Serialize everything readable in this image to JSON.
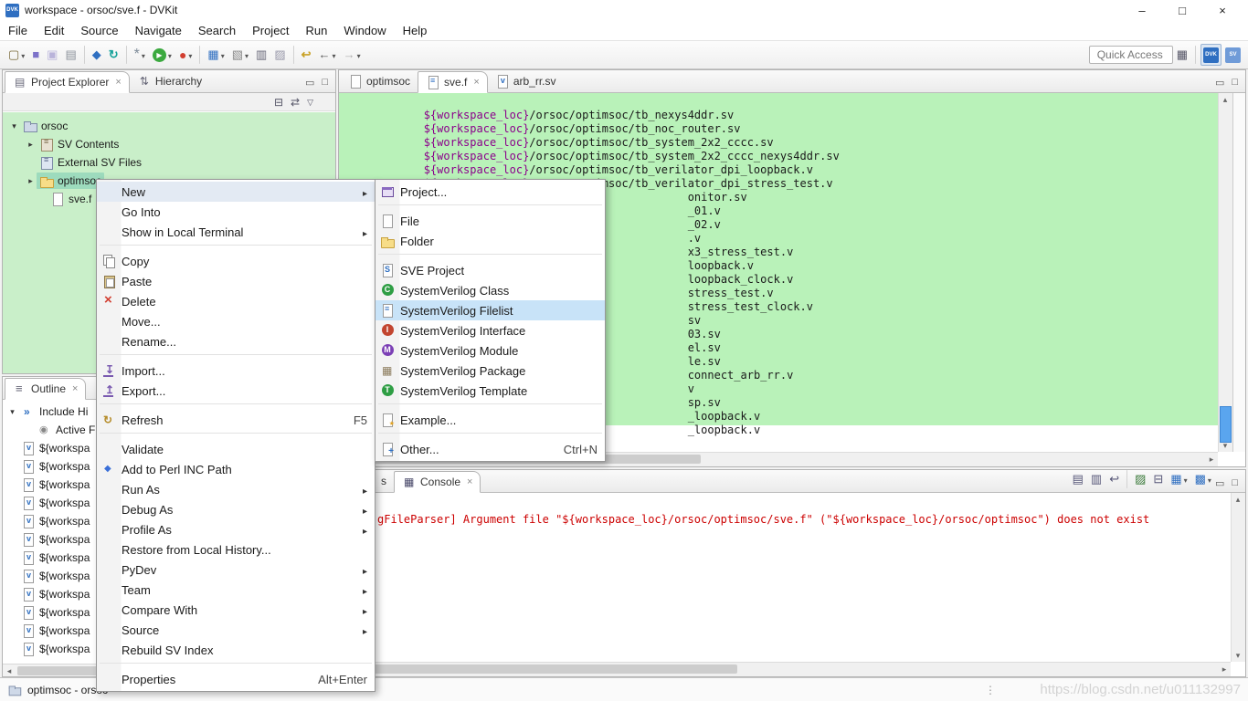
{
  "window": {
    "title": "workspace - orsoc/sve.f - DVKit",
    "logo_text": "DVK",
    "minimize": "–",
    "maximize": "□",
    "close": "×"
  },
  "menubar": [
    "File",
    "Edit",
    "Source",
    "Navigate",
    "Search",
    "Project",
    "Run",
    "Window",
    "Help"
  ],
  "panel_buttons": {
    "minimize": "▭",
    "maximize": "□"
  },
  "colors": {
    "accent_blue": "#2f6fc1",
    "selection_green": "#b9f2b9",
    "explorer_green": "#c9efc9",
    "tree_selection_green": "#9ddbbd",
    "menu_highlight_blue": "#c8e3f8",
    "error_red": "#cc0000",
    "variable_purple": "#8b008b"
  },
  "toolbar": {
    "quick_access": "Quick Access",
    "buttons": [
      {
        "name": "new-wizard",
        "glyph": "▢",
        "gstyle": "color:#7a6a3a",
        "drop": true
      },
      {
        "name": "save",
        "glyph": "■",
        "gstyle": "color:#7d72c9"
      },
      {
        "name": "save-all",
        "glyph": "▣",
        "gstyle": "color:#b9b3da"
      },
      {
        "name": "print",
        "glyph": "▤",
        "gstyle": "color:#8a9099"
      },
      {
        "cls": "tb-sep"
      },
      {
        "name": "build-sv-index",
        "glyph": "◆",
        "gstyle": "color:#2f6fc1"
      },
      {
        "name": "sync-terminal",
        "glyph": "↻",
        "gstyle": "color:#18a39b;font-weight:bold"
      },
      {
        "cls": "tb-sep"
      },
      {
        "name": "new-sv-item",
        "glyph": "*",
        "gstyle": "color:#7f8c99;font-size:16px",
        "drop": true
      },
      {
        "name": "run",
        "glyph": "▶",
        "gstyle": "color:#fff;background:#3ba93f;border-radius:50%;width:15px;height:15px;line-height:15px;text-align:center;font-size:8px",
        "drop": true
      },
      {
        "name": "run-external-tools",
        "glyph": "●",
        "gstyle": "color:#d23f31;font-size:14px",
        "drop": true
      },
      {
        "cls": "tb-sep"
      },
      {
        "name": "simulate",
        "glyph": "▦",
        "gstyle": "color:#2f6fc1",
        "drop": true
      },
      {
        "name": "coverage",
        "glyph": "▧",
        "gstyle": "color:#888",
        "drop": true
      },
      {
        "name": "windows",
        "glyph": "▥",
        "gstyle": "color:#667"
      },
      {
        "name": "editor-area",
        "glyph": "▨",
        "gstyle": "color:#99a"
      },
      {
        "cls": "tb-sep"
      },
      {
        "name": "last-edit-location",
        "glyph": "↩",
        "gstyle": "color:#c9a227;font-weight:bold"
      },
      {
        "name": "back",
        "glyph": "←",
        "gstyle": "color:#555;font-weight:bold",
        "drop": true
      },
      {
        "name": "forward",
        "glyph": "→",
        "gstyle": "color:#b0b0b0;font-weight:bold",
        "drop": true
      }
    ],
    "right_buttons": [
      {
        "name": "open-perspective",
        "glyph": "▦",
        "gstyle": "color:#556"
      },
      {
        "cls": "tb-sep"
      },
      {
        "name": "perspective-dvkit",
        "logo": "DVK",
        "cls": "persp active"
      },
      {
        "name": "perspective-sve",
        "logo": "SV",
        "cls": "persp persp2"
      }
    ]
  },
  "explorer": {
    "tabs": [
      {
        "label": "Project Explorer",
        "icon": "ic-explorer",
        "cls": "active",
        "close": "×"
      },
      {
        "label": "Hierarchy",
        "icon": "ic-hierarchy"
      }
    ],
    "toolbar": [
      {
        "name": "collapse-all",
        "glyph": "⊟",
        "gstyle": "color:#556;font-size:12px"
      },
      {
        "name": "link-with-editor",
        "glyph": "⇄",
        "gstyle": "color:#556;font-size:12px"
      },
      {
        "name": "view-menu",
        "glyph": "▽",
        "gstyle": "color:#556;font-size:9px"
      }
    ],
    "tree": [
      {
        "label": "orsoc",
        "arrow": "▾",
        "icon": "ic-project",
        "style": "padding-left:6px"
      },
      {
        "label": "SV Contents",
        "arrow": "▸",
        "icon": "ic-library",
        "style": "padding-left:24px"
      },
      {
        "label": "External SV Files",
        "arrow": "",
        "icon": "ic-extlib",
        "style": "padding-left:24px"
      },
      {
        "label": "optimsoc",
        "arrow": "▸",
        "icon": "ic-folder",
        "style": "padding-left:24px",
        "selcls": "sel"
      },
      {
        "label": "sve.f",
        "arrow": "",
        "icon": "ic-file",
        "style": "padding-left:36px"
      }
    ]
  },
  "outline": {
    "tabs": [
      {
        "label": "Outline",
        "icon": "ic-outline",
        "cls": "active",
        "close": "×"
      }
    ],
    "items": [
      {
        "label": "Include Hi",
        "arrow": "▾",
        "icon": "ic-includes"
      },
      {
        "label": "Active F",
        "arrow": "",
        "icon": "ic-active",
        "style": "padding-left:18px"
      },
      {
        "label": "${workspa",
        "arrow": "",
        "icon": "ic-vfile"
      },
      {
        "label": "${workspa",
        "arrow": "",
        "icon": "ic-vfile"
      },
      {
        "label": "${workspa",
        "arrow": "",
        "icon": "ic-vfile"
      },
      {
        "label": "${workspa",
        "arrow": "",
        "icon": "ic-vfile"
      },
      {
        "label": "${workspa",
        "arrow": "",
        "icon": "ic-vfile"
      },
      {
        "label": "${workspa",
        "arrow": "",
        "icon": "ic-vfile"
      },
      {
        "label": "${workspa",
        "arrow": "",
        "icon": "ic-vfile"
      },
      {
        "label": "${workspa",
        "arrow": "",
        "icon": "ic-vfile"
      },
      {
        "label": "${workspa",
        "arrow": "",
        "icon": "ic-vfile"
      },
      {
        "label": "${workspa",
        "arrow": "",
        "icon": "ic-vfile"
      },
      {
        "label": "${workspa",
        "arrow": "",
        "icon": "ic-vfile"
      },
      {
        "label": "${workspa",
        "arrow": "",
        "icon": "ic-vfile"
      }
    ]
  },
  "editor": {
    "tabs": [
      {
        "label": "optimsoc",
        "icon": "ic-file"
      },
      {
        "label": "sve.f",
        "icon": "ic-svfilelist",
        "cls": "active",
        "close": "×"
      },
      {
        "label": "arb_rr.sv",
        "icon": "ic-vfile"
      }
    ],
    "lines": [
      {
        "v": "${workspace_loc}",
        "t": "/orsoc/optimsoc/tb_nexys4ddr.sv",
        "style": "padding-left:6px"
      },
      {
        "v": "${workspace_loc}",
        "t": "/orsoc/optimsoc/tb_noc_router.sv",
        "style": "padding-left:6px"
      },
      {
        "v": "${workspace_loc}",
        "t": "/orsoc/optimsoc/tb_system_2x2_cccc.sv",
        "style": "padding-left:6px"
      },
      {
        "v": "${workspace_loc}",
        "t": "/orsoc/optimsoc/tb_system_2x2_cccc_nexys4ddr.sv",
        "style": "padding-left:6px"
      },
      {
        "v": "${workspace_loc}",
        "t": "/orsoc/optimsoc/tb_verilator_dpi_loopback.v",
        "style": "padding-left:6px"
      },
      {
        "v": "${workspace_loc}",
        "t": "/orsoc/optimsoc/tb_verilator_dpi_stress_test.v",
        "style": "padding-left:6px"
      },
      {
        "v": "",
        "t": "onitor.sv",
        "style": "padding-left:295px"
      },
      {
        "v": "",
        "t": "_01.v",
        "style": "padding-left:295px"
      },
      {
        "v": "",
        "t": "_02.v",
        "style": "padding-left:295px"
      },
      {
        "v": "",
        "t": ".v",
        "style": "padding-left:295px"
      },
      {
        "v": "",
        "t": "x3_stress_test.v",
        "style": "padding-left:295px"
      },
      {
        "v": "",
        "t": "loopback.v",
        "style": "padding-left:295px"
      },
      {
        "v": "",
        "t": "loopback_clock.v",
        "style": "padding-left:295px"
      },
      {
        "v": "",
        "t": "stress_test.v",
        "style": "padding-left:295px"
      },
      {
        "v": "",
        "t": "stress_test_clock.v",
        "style": "padding-left:295px"
      },
      {
        "v": "",
        "t": "sv",
        "style": "padding-left:295px"
      },
      {
        "v": "",
        "t": "03.sv",
        "style": "padding-left:295px"
      },
      {
        "v": "",
        "t": "el.sv",
        "style": "padding-left:295px"
      },
      {
        "v": "",
        "t": "le.sv",
        "style": "padding-left:295px"
      },
      {
        "v": "",
        "t": "connect_arb_rr.v",
        "style": "padding-left:295px"
      },
      {
        "v": "",
        "t": "v",
        "style": "padding-left:295px"
      },
      {
        "v": "",
        "t": "sp.sv",
        "style": "padding-left:295px"
      },
      {
        "v": "",
        "t": "_loopback.v",
        "style": "padding-left:295px"
      },
      {
        "v": "",
        "t": "_loopback.v",
        "style": "padding-left:295px"
      }
    ]
  },
  "console": {
    "tabs": [
      {
        "label": "s",
        "style": "width:60px;justify-content:flex-end"
      },
      {
        "label": "Console",
        "icon": "ic-console",
        "cls": "active",
        "close": "×"
      }
    ],
    "toolbar": [
      {
        "name": "open-console-log",
        "glyph": "▤",
        "gstyle": "color:#557"
      },
      {
        "name": "export-log",
        "glyph": "▥",
        "gstyle": "color:#557"
      },
      {
        "name": "word-wrap",
        "glyph": "↩",
        "gstyle": "color:#557"
      },
      {
        "cls": "tb-sep"
      },
      {
        "name": "clear-console",
        "glyph": "▨",
        "gstyle": "color:#3a7a3a"
      },
      {
        "name": "scroll-lock",
        "glyph": "⊟",
        "gstyle": "color:#557"
      },
      {
        "name": "display-selected-console",
        "glyph": "▦",
        "gstyle": "color:#2f6fc1",
        "drop": true
      },
      {
        "name": "open-console",
        "glyph": "▩",
        "gstyle": "color:#2f6fc1",
        "drop": true
      }
    ],
    "error_text": "gFileParser] Argument file \"${workspace_loc}/orsoc/optimsoc/sve.f\" (\"${workspace_loc}/orsoc/optimsoc\") does not exist"
  },
  "context_menu": {
    "items": [
      {
        "label": "New",
        "submenu": true,
        "cls": "hl"
      },
      {
        "label": "Go Into"
      },
      {
        "label": "Show in Local Terminal",
        "submenu": true
      },
      {
        "cls": "msep"
      },
      {
        "label": "Copy",
        "icon": "ic-copy"
      },
      {
        "label": "Paste",
        "icon": "ic-paste"
      },
      {
        "label": "Delete",
        "icon": "ic-delete"
      },
      {
        "label": "Move..."
      },
      {
        "label": "Rename..."
      },
      {
        "cls": "msep"
      },
      {
        "label": "Import...",
        "icon": "ic-import"
      },
      {
        "label": "Export...",
        "icon": "ic-export"
      },
      {
        "cls": "msep"
      },
      {
        "label": "Refresh",
        "icon": "ic-refresh",
        "shortcut": "F5"
      },
      {
        "cls": "msep"
      },
      {
        "label": "Validate"
      },
      {
        "label": "Add to Perl INC Path",
        "icon": "ic-perl"
      },
      {
        "label": "Run As",
        "submenu": true
      },
      {
        "label": "Debug As",
        "submenu": true
      },
      {
        "label": "Profile As",
        "submenu": true
      },
      {
        "label": "Restore from Local History..."
      },
      {
        "label": "PyDev",
        "submenu": true
      },
      {
        "label": "Team",
        "submenu": true
      },
      {
        "label": "Compare With",
        "submenu": true
      },
      {
        "label": "Source",
        "submenu": true
      },
      {
        "label": "Rebuild SV Index"
      },
      {
        "cls": "msep"
      },
      {
        "label": "Properties",
        "shortcut": "Alt+Enter"
      }
    ]
  },
  "new_submenu": {
    "items": [
      {
        "label": "Project...",
        "icon": "ic-newproj"
      },
      {
        "cls": "msep"
      },
      {
        "label": "File",
        "icon": "ic-file"
      },
      {
        "label": "Folder",
        "icon": "ic-folder"
      },
      {
        "cls": "msep"
      },
      {
        "label": "SVE Project",
        "icon": "ic-sveproj"
      },
      {
        "label": "SystemVerilog Class",
        "icon": "ic-svclass"
      },
      {
        "label": "SystemVerilog Filelist",
        "icon": "ic-svfilelist",
        "cls": "hl-blue"
      },
      {
        "label": "SystemVerilog Interface",
        "icon": "ic-svinterface"
      },
      {
        "label": "SystemVerilog Module",
        "icon": "ic-svmodule"
      },
      {
        "label": "SystemVerilog Package",
        "icon": "ic-svpackage"
      },
      {
        "label": "SystemVerilog Template",
        "icon": "ic-svtemplate"
      },
      {
        "cls": "msep"
      },
      {
        "label": "Example...",
        "icon": "ic-example"
      },
      {
        "cls": "msep"
      },
      {
        "label": "Other...",
        "icon": "ic-other",
        "shortcut": "Ctrl+N"
      }
    ]
  },
  "statusbar": {
    "label": "optimsoc - orsoc",
    "grip": "⋮",
    "watermark": "https://blog.csdn.net/u011132997"
  }
}
